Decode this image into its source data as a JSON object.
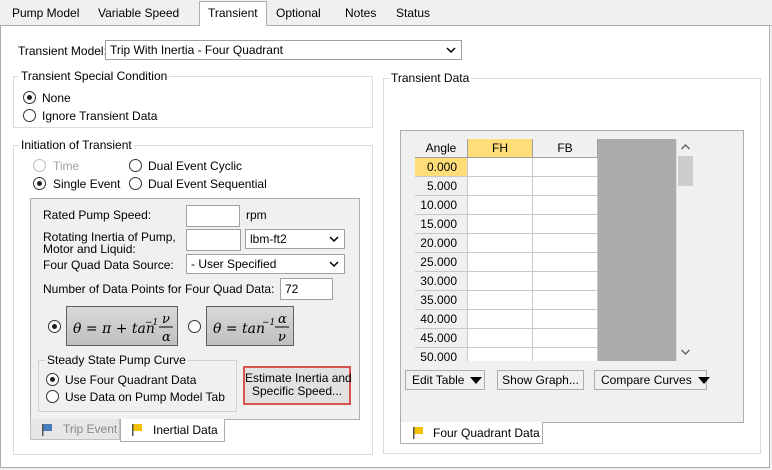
{
  "tabs": [
    "Pump Model",
    "Variable Speed",
    "Transient",
    "Optional",
    "Notes",
    "Status"
  ],
  "active_tab": "Transient",
  "transient_model": {
    "label": "Transient Model:",
    "value": "Trip With Inertia - Four Quadrant"
  },
  "special_condition": {
    "title": "Transient Special Condition",
    "options": [
      "None",
      "Ignore Transient Data"
    ],
    "selected": "None"
  },
  "initiation": {
    "title": "Initiation of Transient",
    "options": {
      "time": "Time",
      "single_event": "Single Event",
      "dual_cyclic": "Dual Event Cyclic",
      "dual_sequential": "Dual Event Sequential"
    },
    "selected": "Single Event"
  },
  "inertial": {
    "rated_speed_label": "Rated Pump Speed:",
    "rated_speed_value": "",
    "rated_speed_unit": "rpm",
    "inertia_label_line1": "Rotating Inertia of Pump,",
    "inertia_label_line2": "Motor and Liquid:",
    "inertia_value": "",
    "inertia_unit": "lbm-ft2",
    "source_label": "Four Quad Data Source:",
    "source_value": "- User Specified",
    "points_label": "Number of Data Points for Four Quad Data:",
    "points_value": "72",
    "formula1": "θ = π + tan⁻¹(ν/α)",
    "formula2": "θ = tan⁻¹(α/ν)",
    "formula_selected": 1
  },
  "steady_state": {
    "title": "Steady State Pump Curve",
    "options": [
      "Use Four Quadrant Data",
      "Use Data on Pump Model Tab"
    ],
    "selected": "Use Four Quadrant Data"
  },
  "estimate_button": {
    "line1": "Estimate Inertia and",
    "line2": "Specific Speed..."
  },
  "bottom_tabs": {
    "trip_event": "Trip Event",
    "inertial_data": "Inertial Data"
  },
  "transient_data": {
    "title": "Transient Data",
    "columns": [
      "Angle",
      "FH",
      "FB"
    ],
    "rows": [
      "0.000",
      "5.000",
      "10.000",
      "15.000",
      "20.000",
      "25.000",
      "30.000",
      "35.000",
      "40.000",
      "45.000",
      "50.000"
    ],
    "buttons": {
      "edit_table": "Edit Table",
      "show_graph": "Show Graph...",
      "compare_curves": "Compare Curves"
    },
    "tab": "Four Quadrant Data"
  },
  "colors": {
    "highlight": "#ffde7a",
    "estimate_border": "#d9534f"
  }
}
